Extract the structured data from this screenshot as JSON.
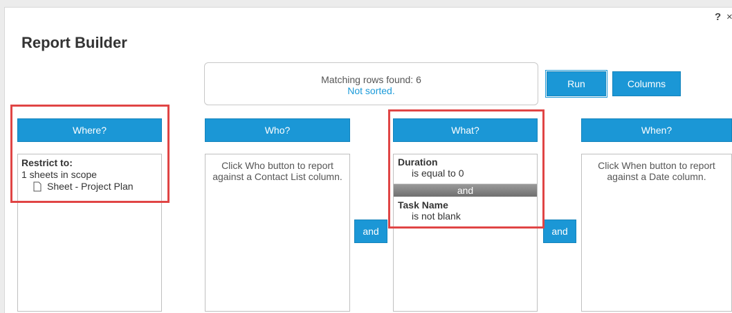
{
  "dialog": {
    "title": "Report Builder",
    "help": "?",
    "close": "×"
  },
  "status": {
    "matching": "Matching rows found: 6",
    "sort": "Not sorted."
  },
  "toolbar": {
    "run_label": "Run",
    "columns_label": "Columns"
  },
  "columns": {
    "where": {
      "label": "Where?",
      "restrict_title": "Restrict to:",
      "scope": "1 sheets in scope",
      "sheet": "Sheet - Project Plan"
    },
    "who": {
      "label": "Who?",
      "hint": "Click Who button to report against a Contact List column."
    },
    "what": {
      "label": "What?",
      "conditions": [
        {
          "name": "Duration",
          "rule": "is equal to 0"
        },
        {
          "name": "Task Name",
          "rule": "is not blank"
        }
      ],
      "joiner": "and"
    },
    "when": {
      "label": "When?",
      "hint": "Click When button to report against a Date column."
    }
  },
  "connectors": {
    "and_1": "and",
    "and_2": "and"
  },
  "colors": {
    "accent": "#1b97d6",
    "highlight": "#e04545",
    "link": "#1a9ad9"
  }
}
